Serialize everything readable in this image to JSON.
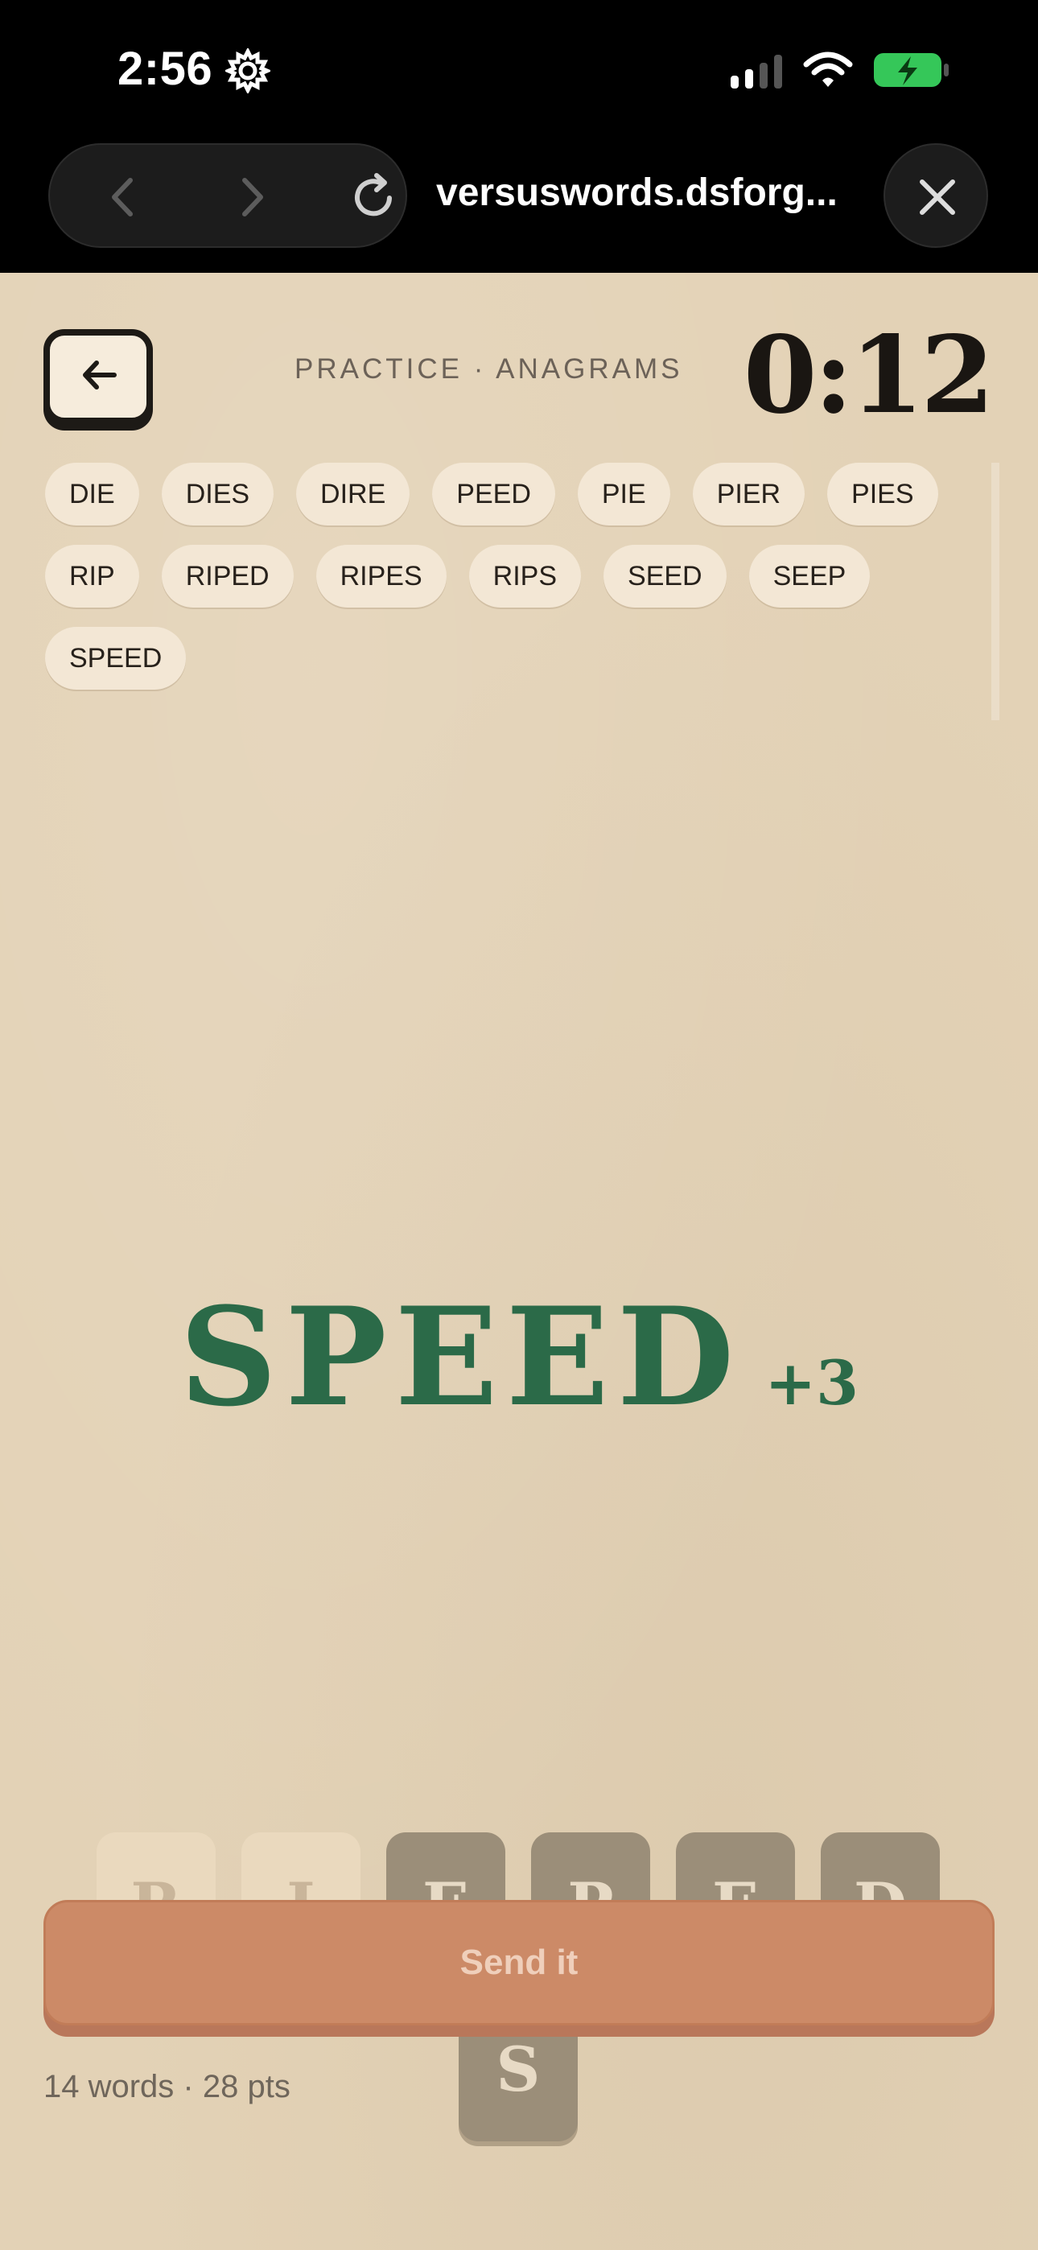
{
  "status_bar": {
    "time": "2:56",
    "icons": [
      "gear-icon",
      "signal-icon",
      "wifi-icon",
      "battery-charging-icon"
    ]
  },
  "browser": {
    "url": "versuswords.dsforg...",
    "icons": [
      "back-icon",
      "forward-icon",
      "reload-icon",
      "close-icon"
    ]
  },
  "header": {
    "mode_label": "PRACTICE · ANAGRAMS",
    "timer": "0:12"
  },
  "found_words": [
    "DIE",
    "DIES",
    "DIRE",
    "PEED",
    "PIE",
    "PIER",
    "PIES",
    "RIP",
    "RIPED",
    "RIPES",
    "RIPS",
    "SEED",
    "SEEP",
    "SPEED"
  ],
  "current": {
    "word": "SPEED",
    "bonus": "+3"
  },
  "tiles": [
    {
      "letter": "R",
      "state": "used"
    },
    {
      "letter": "I",
      "state": "used"
    },
    {
      "letter": "E",
      "state": "available"
    },
    {
      "letter": "P",
      "state": "available"
    },
    {
      "letter": "E",
      "state": "available"
    },
    {
      "letter": "D",
      "state": "available"
    },
    {
      "letter": "S",
      "state": "available"
    }
  ],
  "actions": {
    "send_label": "Send it"
  },
  "summary": "14 words · 28 pts",
  "colors": {
    "word_green": "#2b6a48",
    "send_orange": "#cc8a67",
    "paper": "#e3d2b6"
  }
}
